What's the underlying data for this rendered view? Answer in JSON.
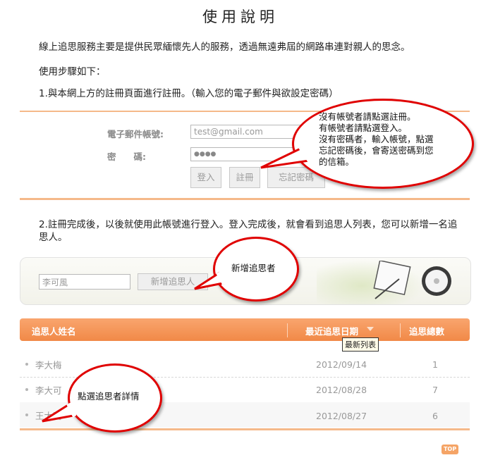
{
  "title": "使用說明",
  "intro": "線上追思服務主要是提供民眾緬懷先人的服務，透過無遠弗屆的網路串連對親人的思念。",
  "steps_heading": "使用步驟如下：",
  "step1": "1.與本網上方的註冊頁面進行註冊。（輸入您的電子郵件與欲設定密碼）",
  "step2": "2.註冊完成後，以後就使用此帳號進行登入。登入完成後，就會看到追思人列表，您可以新增一名追思人。",
  "login": {
    "email_label": "電子郵件帳號:",
    "email_value": "test@gmail.com",
    "password_label": "密　　碼:",
    "password_value": "●●●●",
    "login_button": "登入",
    "register_button": "註冊",
    "forgot_button": "忘記密碼"
  },
  "callout_register": [
    "沒有帳號者請點選註冊。",
    "有帳號者請點選登入。",
    "沒有密碼者，輸入帳號，點選",
    "忘記密碼後，會寄送密碼到您",
    "的信箱。"
  ],
  "add": {
    "name_value": "李可風",
    "add_button": "新增追思人"
  },
  "callout_add": "新增追思者",
  "table": {
    "headers": [
      "追思人姓名",
      "最近追思日期",
      "追思總數"
    ],
    "tooltip": "最新列表",
    "rows": [
      {
        "name": "李大梅",
        "date": "2012/09/14",
        "count": "1"
      },
      {
        "name": "李大可",
        "date": "2012/08/28",
        "count": "7"
      },
      {
        "name": "王大寶",
        "date": "2012/08/27",
        "count": "6"
      }
    ]
  },
  "callout_detail": "點選追思者詳情",
  "top_button": "TOP",
  "colors": {
    "accent": "#f18947",
    "callout": "#e00000",
    "rule": "#f5b98a"
  }
}
